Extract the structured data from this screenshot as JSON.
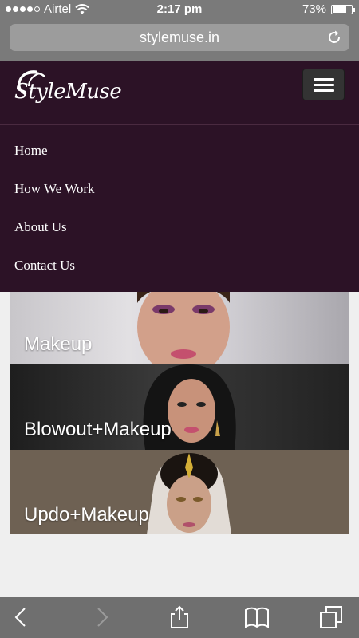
{
  "status_bar": {
    "carrier": "Airtel",
    "time": "2:17 pm",
    "battery": "73%",
    "battery_level": 0.73
  },
  "browser": {
    "url": "stylemuse.in"
  },
  "header": {
    "logo_text": "StyleMuse"
  },
  "nav": {
    "items": [
      {
        "label": "Home"
      },
      {
        "label": "How We Work"
      },
      {
        "label": "About Us"
      },
      {
        "label": "Contact Us"
      }
    ]
  },
  "services": [
    {
      "label": "Makeup"
    },
    {
      "label": "Blowout+Makeup"
    },
    {
      "label": "Updo+Makeup"
    }
  ],
  "colors": {
    "header_bg": "#2c1226",
    "page_bg": "#efefef"
  }
}
